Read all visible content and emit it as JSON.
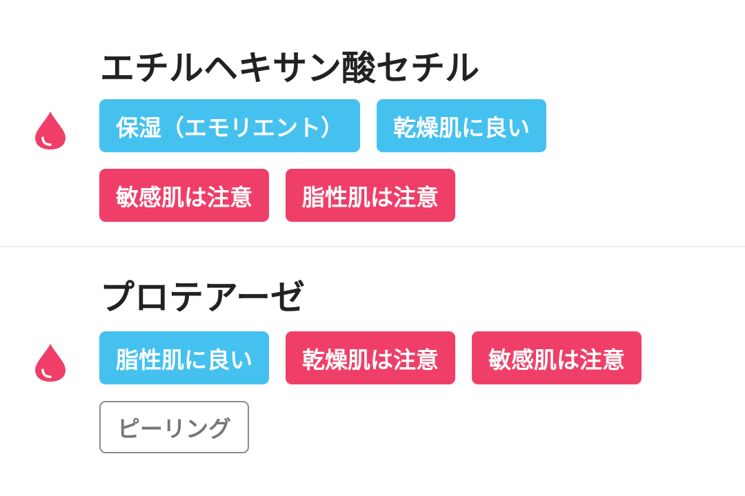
{
  "colors": {
    "good": "#45c1ef",
    "caution": "#ef3f68",
    "neutral_border": "#8a8a8a",
    "drop_icon": "#ef3f68"
  },
  "ingredients": [
    {
      "name": "エチルヘキサン酸セチル",
      "icon": "drop-icon",
      "tags": [
        {
          "label": "保湿（エモリエント）",
          "kind": "good"
        },
        {
          "label": "乾燥肌に良い",
          "kind": "good"
        },
        {
          "label": "敏感肌は注意",
          "kind": "caution"
        },
        {
          "label": "脂性肌は注意",
          "kind": "caution"
        }
      ]
    },
    {
      "name": "プロテアーゼ",
      "icon": "drop-icon",
      "tags": [
        {
          "label": "脂性肌に良い",
          "kind": "good"
        },
        {
          "label": "乾燥肌は注意",
          "kind": "caution"
        },
        {
          "label": "敏感肌は注意",
          "kind": "caution"
        },
        {
          "label": "ピーリング",
          "kind": "neutral"
        }
      ]
    }
  ]
}
